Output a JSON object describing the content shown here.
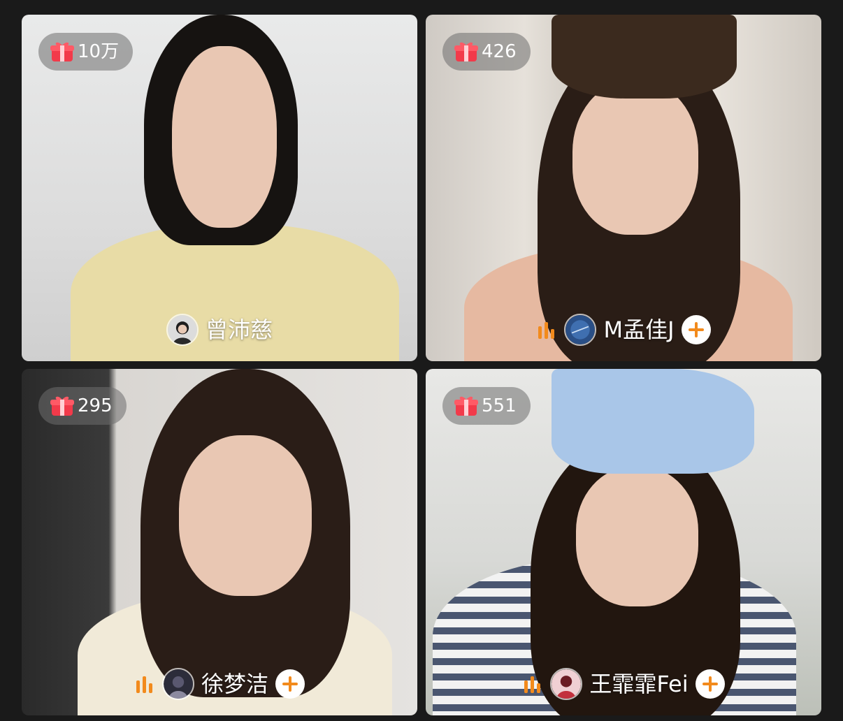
{
  "tiles": [
    {
      "gift_count": "10万",
      "name": "曾沛慈",
      "follow": false,
      "speaking": false
    },
    {
      "gift_count": "426",
      "name": "M孟佳J",
      "follow": true,
      "speaking": true
    },
    {
      "gift_count": "295",
      "name": "徐梦洁",
      "follow": true,
      "speaking": true
    },
    {
      "gift_count": "551",
      "name": "王霏霏Fei",
      "follow": true,
      "speaking": true
    }
  ],
  "icons": {
    "gift": "gift-icon",
    "speaking": "audio-bars-icon",
    "follow": "plus-icon"
  },
  "colors": {
    "gift_red": "#f23a4a",
    "speaking_orange": "#f28a1c",
    "follow_orange": "#f28a1c"
  }
}
